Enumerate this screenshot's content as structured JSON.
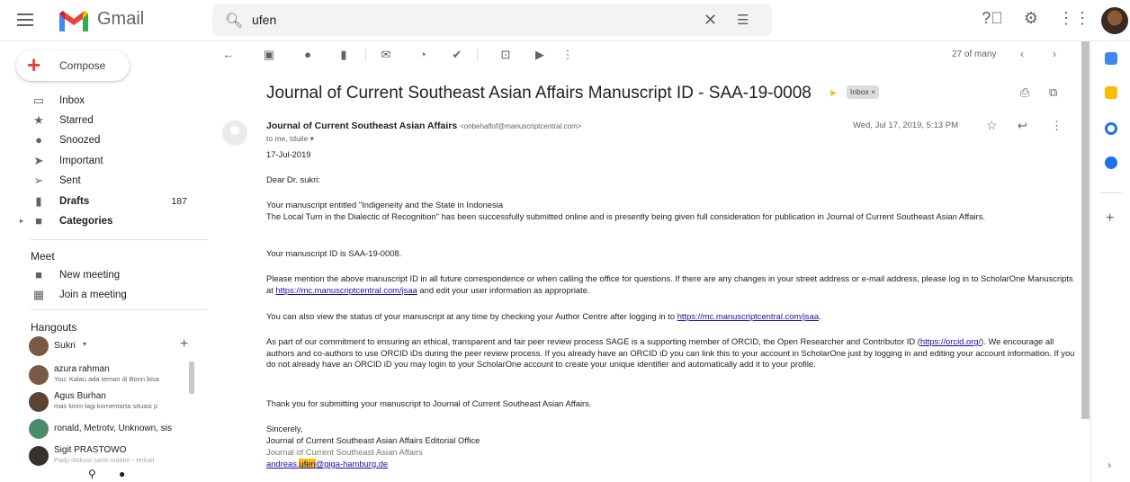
{
  "app": {
    "name": "Gmail",
    "search_value": "ufen",
    "search_icon": "search-icon",
    "clear_icon": "close-icon",
    "tune_icon": "tune-icon"
  },
  "header_icons": [
    "help-icon",
    "settings-icon",
    "apps-icon"
  ],
  "sidebar": {
    "compose": "Compose",
    "items": [
      {
        "label": "Inbox",
        "count": ""
      },
      {
        "label": "Starred",
        "count": ""
      },
      {
        "label": "Snoozed",
        "count": ""
      },
      {
        "label": "Important",
        "count": ""
      },
      {
        "label": "Sent",
        "count": ""
      },
      {
        "label": "Drafts",
        "count": "187"
      },
      {
        "label": "Categories",
        "count": ""
      }
    ],
    "meet": {
      "title": "Meet",
      "items": [
        "New meeting",
        "Join a meeting"
      ]
    },
    "hangouts": {
      "title": "Hangouts",
      "self": "Sukri",
      "conversations": [
        {
          "name": "azura rahman",
          "snippet": "You: Kalau ada teman di Bonn bisa"
        },
        {
          "name": "Agus Burhan",
          "snippet": "mas kirim lagi komentarta situasi p"
        },
        {
          "name": "ronald, Metrotv, Unknown, sis",
          "snippet": ""
        },
        {
          "name": "Sigit PRASTOWO",
          "snippet": "Pady diskusi santi malam - terkait"
        }
      ]
    }
  },
  "toolbar": {
    "pager": "27 of many"
  },
  "email": {
    "subject": "Journal of Current Southeast Asian Affairs Manuscript ID - SAA-19-0008",
    "label_chip": "Inbox ×",
    "sender_name": "Journal of Current Southeast Asian Affairs",
    "sender_email": "<onbehalfof@manuscriptcentral.com>",
    "to": "to me, tduile ▾",
    "date": "Wed, Jul 17, 2019, 5:13 PM",
    "body": {
      "date": "17-Jul-2019",
      "greeting": "Dear Dr. sukri:",
      "p1_line1": "Your manuscript entitled \"Indigeneity and the State in Indonesia",
      "p1_line2": "The Local Turn in the Dialectic of Recognition\" has been successfully submitted online and is presently being given full consideration for publication in Journal of Current Southeast Asian Affairs.",
      "p2": "Your manuscript ID is SAA-19-0008.",
      "p3_a": "Please mention the above manuscript ID in all future correspondence or when calling the office for questions. If there are any changes in your street address or e-mail address, please log in to ScholarOne Manuscripts at ",
      "p3_link": "https://mc.manuscriptcentral.com/jsaa",
      "p3_b": " and edit your user information as appropriate.",
      "p4_a": "You can also view the status of your manuscript at any time by checking your Author Centre after logging in to ",
      "p4_link": "https://mc.manuscriptcentral.com/jsaa",
      "p4_b": ".",
      "p5_a": "As part of our commitment to ensuring an ethical, transparent and fair peer review process SAGE is a supporting member of ORCID, the Open Researcher and Contributor ID (",
      "p5_link": "https://orcid.org/",
      "p5_b": "). We encourage all authors and co-authors to use ORCID iDs during the peer review process. If you already have an ORCID iD you can link this to your account in ScholarOne just by logging in and editing your account information. If you do not already have an ORCID iD you may login to your ScholarOne account to create your unique identifier and automatically add it to your profile.",
      "p6": "Thank you for submitting your manuscript to Journal of Current Southeast Asian Affairs.",
      "sig1": "Sincerely,",
      "sig2": "Journal of Current Southeast Asian Affairs Editorial Office",
      "sig3": "Journal of Current Southeast Asian Affairs",
      "sig_email_a": "andreas.",
      "sig_email_hl": "ufen",
      "sig_email_b": "@giga-hamburg.de"
    }
  }
}
